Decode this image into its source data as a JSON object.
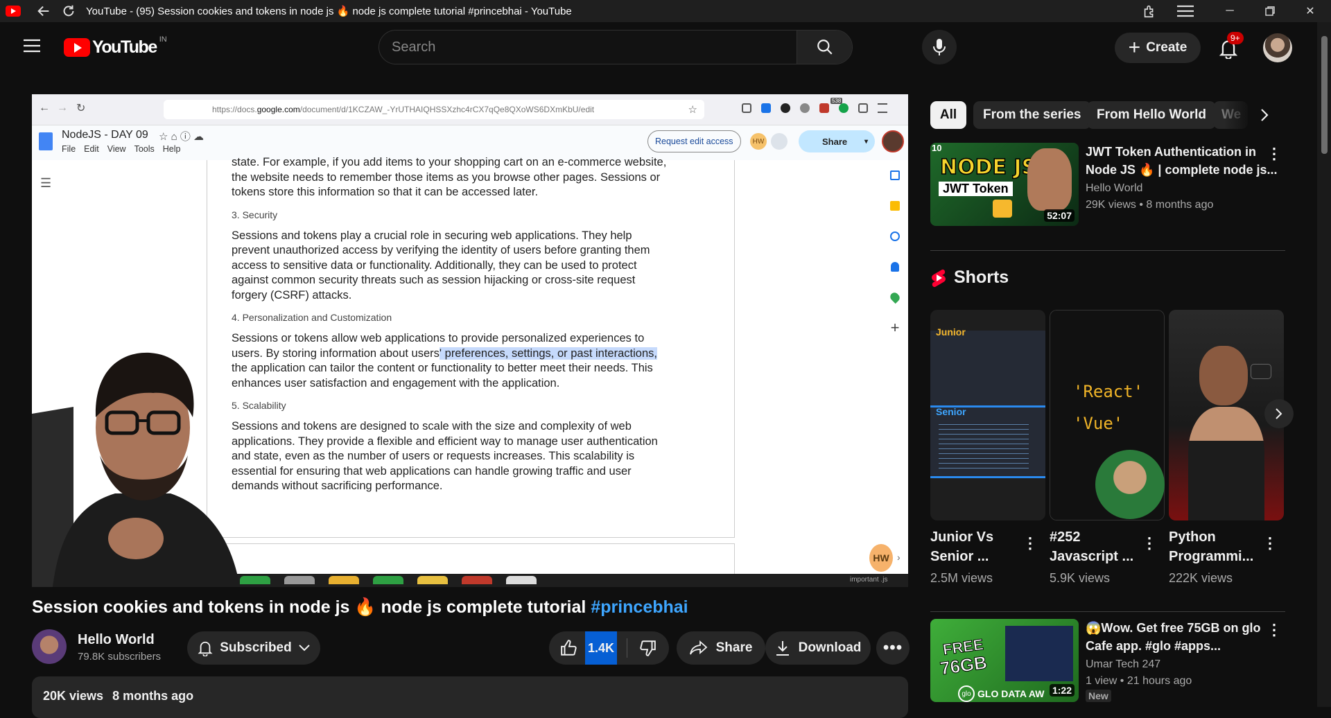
{
  "window": {
    "title": "YouTube - (95) Session cookies and tokens in node js 🔥 node js complete tutorial #princebhai - YouTube"
  },
  "masthead": {
    "logo_text": "YouTube",
    "region": "IN",
    "search_placeholder": "Search",
    "create_label": "Create",
    "notif_count": "9+"
  },
  "doc_browser": {
    "url_prefix": "https://docs.",
    "url_domain": "google.com",
    "url_rest": "/document/d/1KCZAW_-YrUTHAIQHSSXzhc4rCX7qQe8QXoWS6DXmKbU/edit",
    "ext_badge": "538",
    "doc_title": "NodeJS - DAY 09",
    "menu": [
      "File",
      "Edit",
      "View",
      "Tools",
      "Help"
    ],
    "request_edit": "Request edit access",
    "share": "Share",
    "avatar_initials": "HW",
    "text_top_1": "state. For example, if you add items to your shopping cart on an e-commerce website,",
    "text_top_2": "the website needs to remember those items as you browse other pages. Sessions or",
    "text_top_3": "tokens store this information so that it can be accessed later.",
    "h3": "3. Security",
    "p3": [
      "Sessions and tokens play a crucial role in securing web applications. They help",
      "prevent unauthorized access by verifying the identity of users before granting them",
      "access to sensitive data or functionality. Additionally, they can be used to protect",
      "against common security threats such as session hijacking or cross-site request",
      "forgery (CSRF) attacks."
    ],
    "h4": "4. Personalization and Customization",
    "p4_1": "Sessions or tokens allow web applications to provide personalized experiences to",
    "p4_2a": "users. By storing information about users",
    "p4_2b": "' preferences, settings, or past interactions,",
    "p4_3": "the application can tailor the content or functionality to better meet their needs. This",
    "p4_4": "enhances user satisfaction and engagement with the application.",
    "h5": "5. Scalability",
    "p5": [
      "Sessions and tokens are designed to scale with the size and complexity of web",
      "applications. They provide a flexible and efficient way to manage user authentication",
      "and state, even as the number of users or requests increases. This scalability is",
      "essential for ensuring that web applications can handle growing traffic and user",
      "demands without sacrificing performance."
    ],
    "dock_text": "important .js"
  },
  "video": {
    "title_main": "Session cookies and tokens in node js 🔥 node js complete tutorial ",
    "title_tag": "#princebhai",
    "channel": "Hello World",
    "subscribers": "79.8K subscribers",
    "subscribed_label": "Subscribed",
    "likes": "1.4K",
    "share_label": "Share",
    "download_label": "Download",
    "views": "20K views",
    "age": "8 months ago"
  },
  "sidebar": {
    "chips": [
      "All",
      "From the series",
      "From Hello World",
      "We"
    ],
    "rec1": {
      "title_line1": "JWT Token Authentication in",
      "title_line2": "Node JS 🔥 | complete node js...",
      "channel": "Hello World",
      "views": "29K views",
      "age": "8 months ago",
      "duration": "52:07",
      "thumb_line1": "NODE JS",
      "thumb_line2": "JWT Token",
      "thumb_badge": "10"
    },
    "shorts_heading": "Shorts",
    "shorts": [
      {
        "title1": "Junior Vs",
        "title2": "Senior ...",
        "views": "2.5M views",
        "label_top": "Junior",
        "label_bottom": "Senior"
      },
      {
        "title1": "#252",
        "title2": "Javascript ...",
        "views": "5.9K views",
        "code1": "'React'",
        "code2": "'Vue'"
      },
      {
        "title1": "Python",
        "title2": "Programmi...",
        "views": "222K views"
      }
    ],
    "rec2": {
      "title_line1": "😱Wow. Get free 75GB on glo",
      "title_line2": "Cafe app. #glo #apps...",
      "channel": "Umar Tech 247",
      "views": "1 view",
      "age": "21 hours ago",
      "badge": "New",
      "duration": "1:22",
      "thumb_line1": "FREE",
      "thumb_line2": "76GB",
      "thumb_footer": "GLO DATA AW"
    }
  },
  "colors": {
    "yt_red": "#ff0000",
    "link_blue": "#3ea6ff",
    "bg": "#0f0f0f",
    "chip_bg": "#272727",
    "like_highlight": "#065fd4",
    "doc_highlight": "#c6dafc"
  }
}
